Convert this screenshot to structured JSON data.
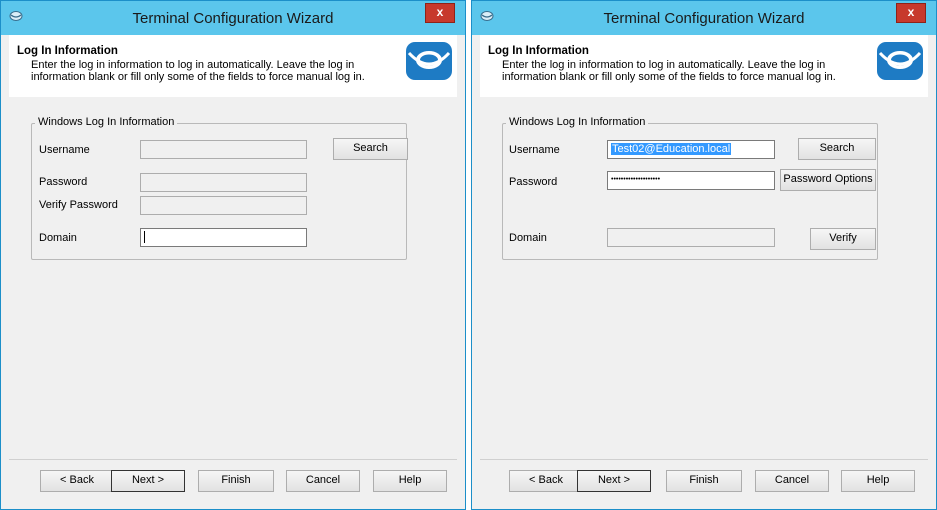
{
  "left": {
    "title": "Terminal Configuration Wizard",
    "close_label": "x",
    "header_title": "Log In Information",
    "header_desc": "Enter the log in information to log in automatically. Leave the log in information blank or fill only some of the fields to force manual log in.",
    "group_label": "Windows Log In Information",
    "username_label": "Username",
    "password_label": "Password",
    "verify_password_label": "Verify Password",
    "domain_label": "Domain",
    "username_value": "",
    "password_value": "",
    "verify_password_value": "",
    "domain_value": "",
    "search_label": "Search",
    "buttons": {
      "back": "< Back",
      "next": "Next >",
      "finish": "Finish",
      "cancel": "Cancel",
      "help": "Help"
    }
  },
  "right": {
    "title": "Terminal Configuration Wizard",
    "close_label": "x",
    "header_title": "Log In Information",
    "header_desc": "Enter the log in information to log in automatically. Leave the log in information blank or fill only some of the fields to force manual log in.",
    "group_label": "Windows Log In Information",
    "username_label": "Username",
    "password_label": "Password",
    "domain_label": "Domain",
    "username_value": "Test02@Education.local",
    "password_value": "••••••••••••••••••••",
    "domain_value": "",
    "search_label": "Search",
    "password_options_label": "Password Options",
    "verify_label": "Verify",
    "buttons": {
      "back": "< Back",
      "next": "Next >",
      "finish": "Finish",
      "cancel": "Cancel",
      "help": "Help"
    }
  },
  "colors": {
    "titlebar": "#5bc6ec",
    "close": "#c7392c",
    "selection": "#3399ff",
    "logo": "#1e7bc4"
  }
}
